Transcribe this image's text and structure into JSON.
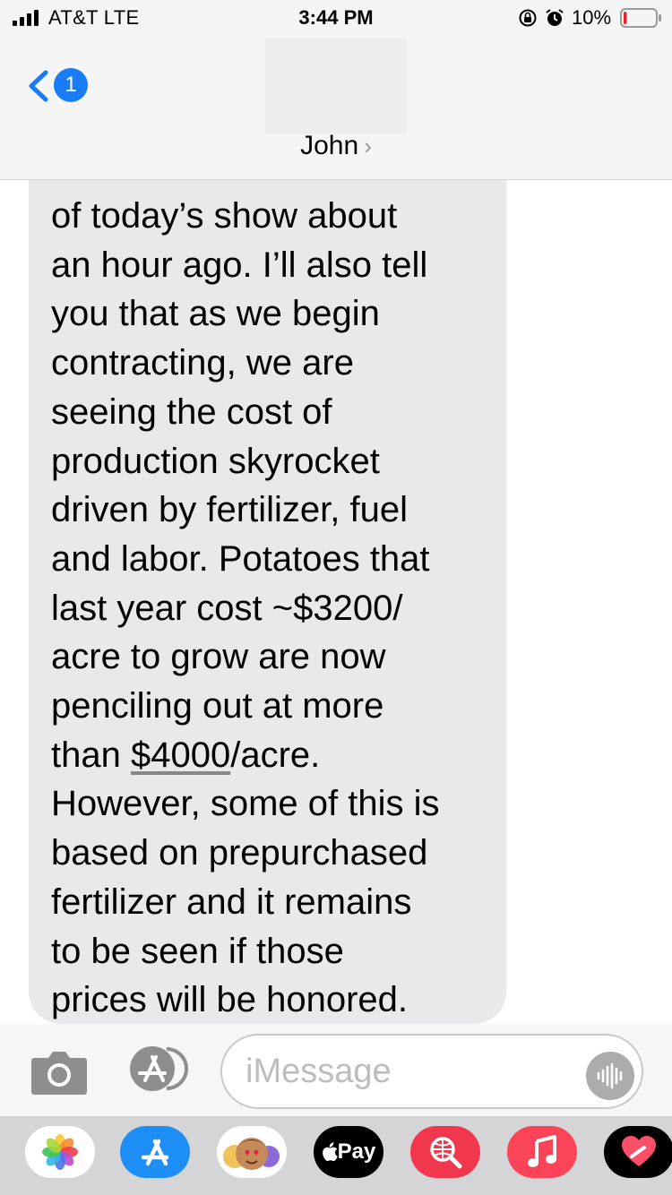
{
  "status_bar": {
    "carrier": "AT&T  LTE",
    "time": "3:44 PM",
    "battery_percent": "10%",
    "battery_level": 0.1
  },
  "header": {
    "unread_count": "1",
    "contact_name": "John",
    "back_icon": "chevron-left-icon"
  },
  "message": {
    "text": "of today’s show about\nan hour ago. I’ll also tell\nyou that as we begin\ncontracting, we are\nseeing the cost of\nproduction skyrocket\ndriven by fertilizer, fuel\nand labor. Potatoes that\nlast year cost ~$3200/\nacre to grow are now\npenciling out at more\nthan ",
    "link_text": "$4000",
    "text_after": "/acre.\nHowever, some of this is\nbased on prepurchased\nfertilizer and it remains\nto be seen if those\nprices will be honored."
  },
  "compose": {
    "placeholder": "iMessage"
  },
  "app_drawer": {
    "apps": [
      "Photos",
      "App Store",
      "Memoji Stickers",
      "Apple Pay",
      "Web Search",
      "Music",
      "Digital Touch"
    ],
    "apple_pay_label": "Pay"
  },
  "colors": {
    "accent": "#1a7cf5",
    "bubble": "#e9e9eb",
    "app_store": "#1d8ef5",
    "search": "#f0374e",
    "music": "#fb4458"
  }
}
